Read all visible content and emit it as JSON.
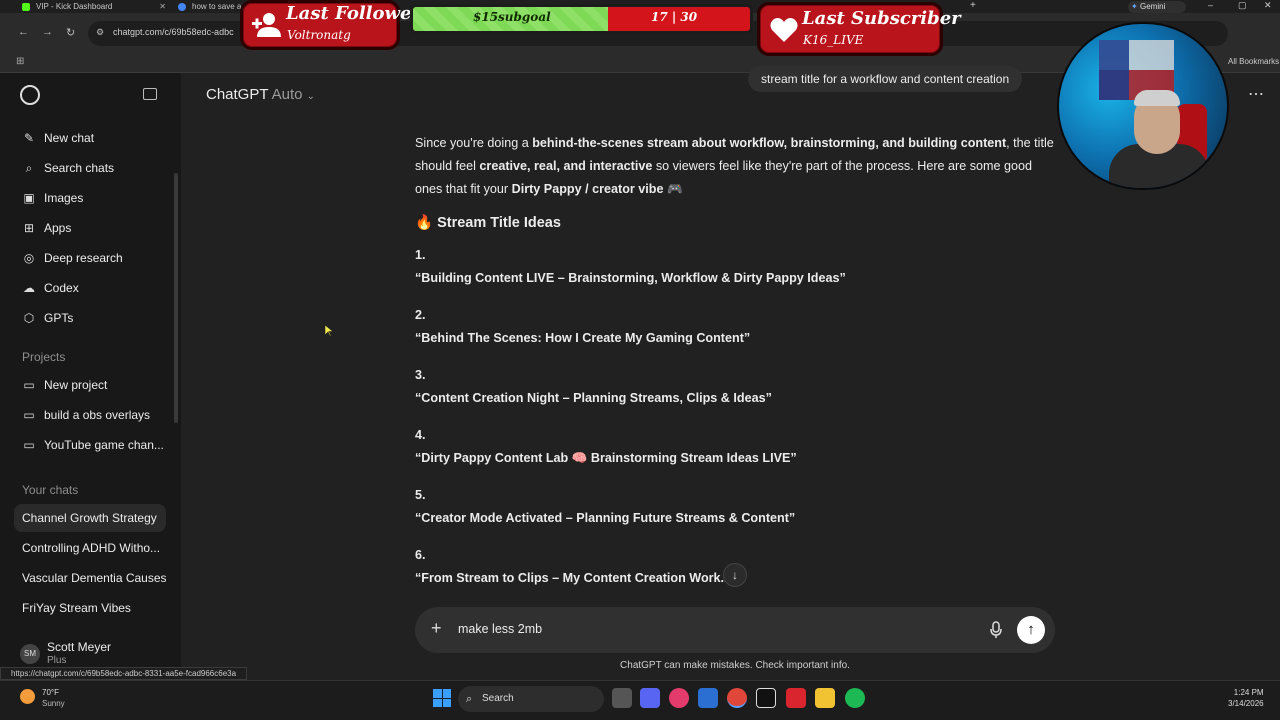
{
  "browser": {
    "tabs": [
      {
        "title": "VIP - Kick Dashboard",
        "icon": "kick-icon",
        "color": "#53fc18"
      },
      {
        "title": "how to save a",
        "icon": "google-icon",
        "color": "#4285f4"
      }
    ],
    "url": "chatgpt.com/c/69b58edc-adbc",
    "bookmarks_label": "All Bookmarks",
    "gemini_label": "Gemini"
  },
  "sidebar": {
    "items": [
      {
        "label": "New chat",
        "icon": "new-chat-icon"
      },
      {
        "label": "Search chats",
        "icon": "search-icon"
      },
      {
        "label": "Images",
        "icon": "images-icon"
      },
      {
        "label": "Apps",
        "icon": "apps-icon"
      },
      {
        "label": "Deep research",
        "icon": "deep-research-icon"
      },
      {
        "label": "Codex",
        "icon": "codex-icon"
      },
      {
        "label": "GPTs",
        "icon": "gpts-icon"
      }
    ],
    "projects_heading": "Projects",
    "projects": [
      {
        "label": "New project",
        "icon": "folder-icon"
      },
      {
        "label": "build a obs overlays",
        "icon": "folder-icon"
      },
      {
        "label": "YouTube game chan...",
        "icon": "folder-icon"
      }
    ],
    "chats_heading": "Your chats",
    "chats": [
      "Channel Growth Strategy",
      "Controlling ADHD Witho...",
      "Vascular Dementia Causes",
      "FriYay Stream Vibes"
    ],
    "user": {
      "initials": "SM",
      "name": "Scott Meyer",
      "plan": "Plus"
    }
  },
  "header": {
    "model": "ChatGPT",
    "model_mode": "Auto"
  },
  "conversation": {
    "user_message": "stream title for a workflow and content creation",
    "intro_parts": [
      "Since you're doing a ",
      "behind-the-scenes stream about workflow, brainstorming, and building content",
      ", the title should feel ",
      "creative, real, and interactive",
      " so viewers feel like they're part of the process. Here are some good ones that fit your ",
      "Dirty Pappy / creator vibe",
      " 🎮"
    ],
    "section_title": "Stream Title Ideas",
    "ideas": [
      {
        "num": "1.",
        "text": "“Building Content LIVE – Brainstorming, Workflow & Dirty Pappy Ideas”"
      },
      {
        "num": "2.",
        "text": "“Behind The Scenes: How I Create My Gaming Content”"
      },
      {
        "num": "3.",
        "text": "“Content Creation Night – Planning Streams, Clips & Ideas”"
      },
      {
        "num": "4.",
        "text": "“Dirty Pappy Content Lab 🧠 Brainstorming Stream Ideas LIVE”"
      },
      {
        "num": "5.",
        "text": "“Creator Mode Activated – Planning Future Streams & Content”"
      },
      {
        "num": "6.",
        "text": "“From Stream to Clips – My Content Creation Work...”"
      }
    ]
  },
  "composer": {
    "value": "make less 2mb",
    "disclaimer": "ChatGPT can make mistakes. Check important info."
  },
  "status_url": "https://chatgpt.com/c/69b58edc-adbc-8331-aa5e-fcad966c6e3a",
  "overlays": {
    "follower_title": "Last Follower",
    "follower_name": "Voltronatg",
    "goal_label": "$15subgoal",
    "goal_count": "17 | 30",
    "goal_progress": 0.58,
    "subscriber_title": "Last Subscriber",
    "subscriber_name": "K16_LIVE"
  },
  "taskbar": {
    "weather_temp": "70°F",
    "weather_desc": "Sunny",
    "search_label": "Search",
    "time": "1:24 PM",
    "date": "3/14/2026"
  },
  "colors": {
    "accent_red": "#b9141b",
    "goal_green": "#7ed957",
    "windows_blue": "#3aa0ff"
  }
}
